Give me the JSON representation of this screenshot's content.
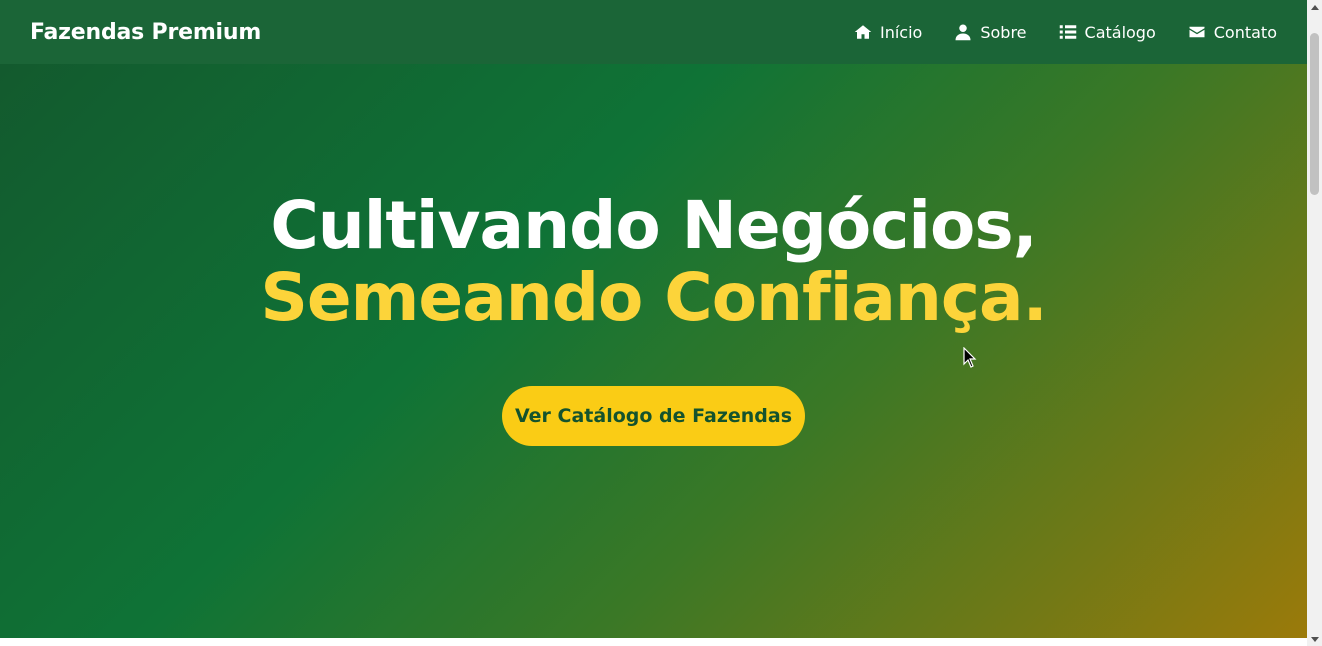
{
  "navbar": {
    "brand": "Fazendas Premium",
    "links": [
      {
        "label": "Início",
        "icon": "home-icon"
      },
      {
        "label": "Sobre",
        "icon": "user-icon"
      },
      {
        "label": "Catálogo",
        "icon": "list-icon"
      },
      {
        "label": "Contato",
        "icon": "envelope-icon"
      }
    ]
  },
  "hero": {
    "title_line1": "Cultivando Negócios,",
    "title_line2": "Semeando Confiança.",
    "cta_label": "Ver Catálogo de Fazendas"
  },
  "colors": {
    "navbar_bg": "#1b6537",
    "accent_yellow": "#facc15",
    "title_yellow": "#fcd43a",
    "cta_text": "#14532d"
  }
}
